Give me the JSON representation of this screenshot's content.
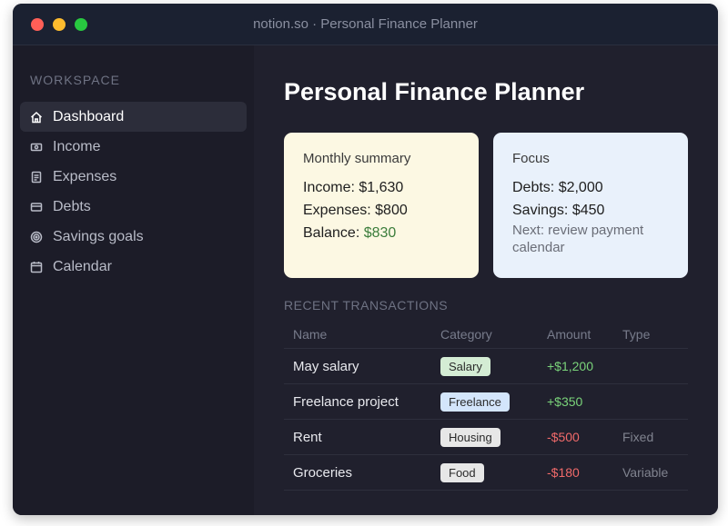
{
  "window": {
    "title": "notion.so · Personal Finance Planner"
  },
  "sidebar": {
    "section_label": "WORKSPACE",
    "items": [
      {
        "label": "Dashboard",
        "icon": "home-icon",
        "active": true
      },
      {
        "label": "Income",
        "icon": "cash-icon"
      },
      {
        "label": "Expenses",
        "icon": "receipt-icon"
      },
      {
        "label": "Debts",
        "icon": "credit-card-icon"
      },
      {
        "label": "Savings goals",
        "icon": "target-icon"
      },
      {
        "label": "Calendar",
        "icon": "calendar-icon"
      }
    ]
  },
  "main": {
    "title": "Personal Finance Planner",
    "summary_card": {
      "heading": "Monthly summary",
      "income": "Income: $1,630",
      "expenses": "Expenses: $800",
      "balance_label": "Balance: ",
      "balance_value": "$830"
    },
    "focus_card": {
      "heading": "Focus",
      "debts": "Debts: $2,000",
      "savings": "Savings: $450",
      "note": "Next: review payment calendar"
    },
    "transactions": {
      "label": "RECENT TRANSACTIONS",
      "columns": [
        "Name",
        "Category",
        "Amount",
        "Type"
      ],
      "rows": [
        {
          "name": "May salary",
          "category": "Salary",
          "amount": "+$1,200",
          "type": ""
        },
        {
          "name": "Freelance project",
          "category": "Freelance",
          "amount": "+$350",
          "type": ""
        },
        {
          "name": "Rent",
          "category": "Housing",
          "amount": "-$500",
          "type": "Fixed"
        },
        {
          "name": "Groceries",
          "category": "Food",
          "amount": "-$180",
          "type": "Variable"
        }
      ]
    }
  },
  "colors": {
    "summary_card_bg": "#fcf8e3",
    "focus_card_bg": "#e9f1fb",
    "positive_amount": "#7ad37a",
    "negative_amount": "#f06a6a",
    "tag_salary": "#d4ecd4",
    "tag_freelance": "#d3e5fb",
    "tag_housing": "#e7e7e7",
    "tag_food": "#e7e7e7"
  }
}
